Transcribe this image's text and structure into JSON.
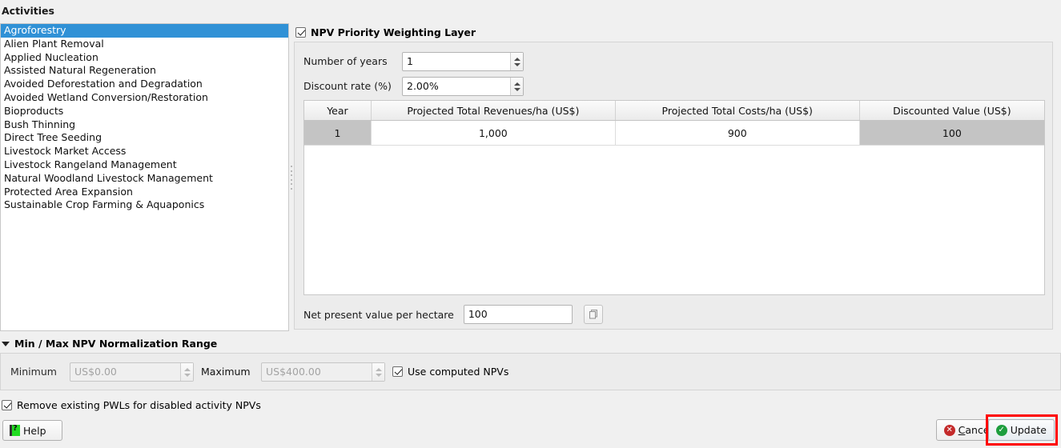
{
  "activities": {
    "title": "Activities",
    "selected_index": 0,
    "items": [
      "Agroforestry",
      "Alien Plant Removal",
      "Applied Nucleation",
      "Assisted Natural Regeneration",
      "Avoided Deforestation and Degradation",
      "Avoided Wetland Conversion/Restoration",
      "Bioproducts",
      "Bush Thinning",
      "Direct Tree Seeding",
      "Livestock Market Access",
      "Livestock Rangeland Management",
      "Natural Woodland Livestock Management",
      "Protected Area Expansion",
      "Sustainable Crop Farming & Aquaponics"
    ]
  },
  "npv_panel": {
    "enable_label": "NPV Priority Weighting Layer",
    "enabled": true,
    "years_label": "Number of years",
    "years_value": "1",
    "discount_label": "Discount rate (%)",
    "discount_value": "2.00%",
    "npv_value_label": "Net present value per hectare",
    "npv_value": "100",
    "copy_icon": "copy-icon"
  },
  "table": {
    "columns": [
      "Year",
      "Projected Total Revenues/ha (US$)",
      "Projected Total Costs/ha (US$)",
      "Discounted Value (US$)"
    ],
    "rows": [
      {
        "year": "1",
        "revenues": "1,000",
        "costs": "900",
        "discounted": "100"
      }
    ]
  },
  "minmax": {
    "section_title": "Min / Max NPV Normalization Range",
    "expanded": true,
    "minimum_label": "Minimum",
    "minimum_placeholder": "US$0.00",
    "maximum_label": "Maximum",
    "maximum_placeholder": "US$400.00",
    "use_computed_label": "Use computed NPVs",
    "use_computed_checked": true,
    "fields_disabled": true
  },
  "bottom": {
    "remove_pwl_label": "Remove existing PWLs for disabled activity NPVs",
    "remove_pwl_checked": true,
    "help_label": "Help",
    "cancel_label": "Cancel",
    "update_label": "Update"
  },
  "colors": {
    "selection_blue": "#3091d6",
    "highlight_red": "#ff0000",
    "cancel_red": "#c42b2b",
    "update_green": "#1e9e3e",
    "help_green": "#22dd22",
    "readonly_grey": "#c4c4c4",
    "window_bg": "#f0f0f0"
  }
}
